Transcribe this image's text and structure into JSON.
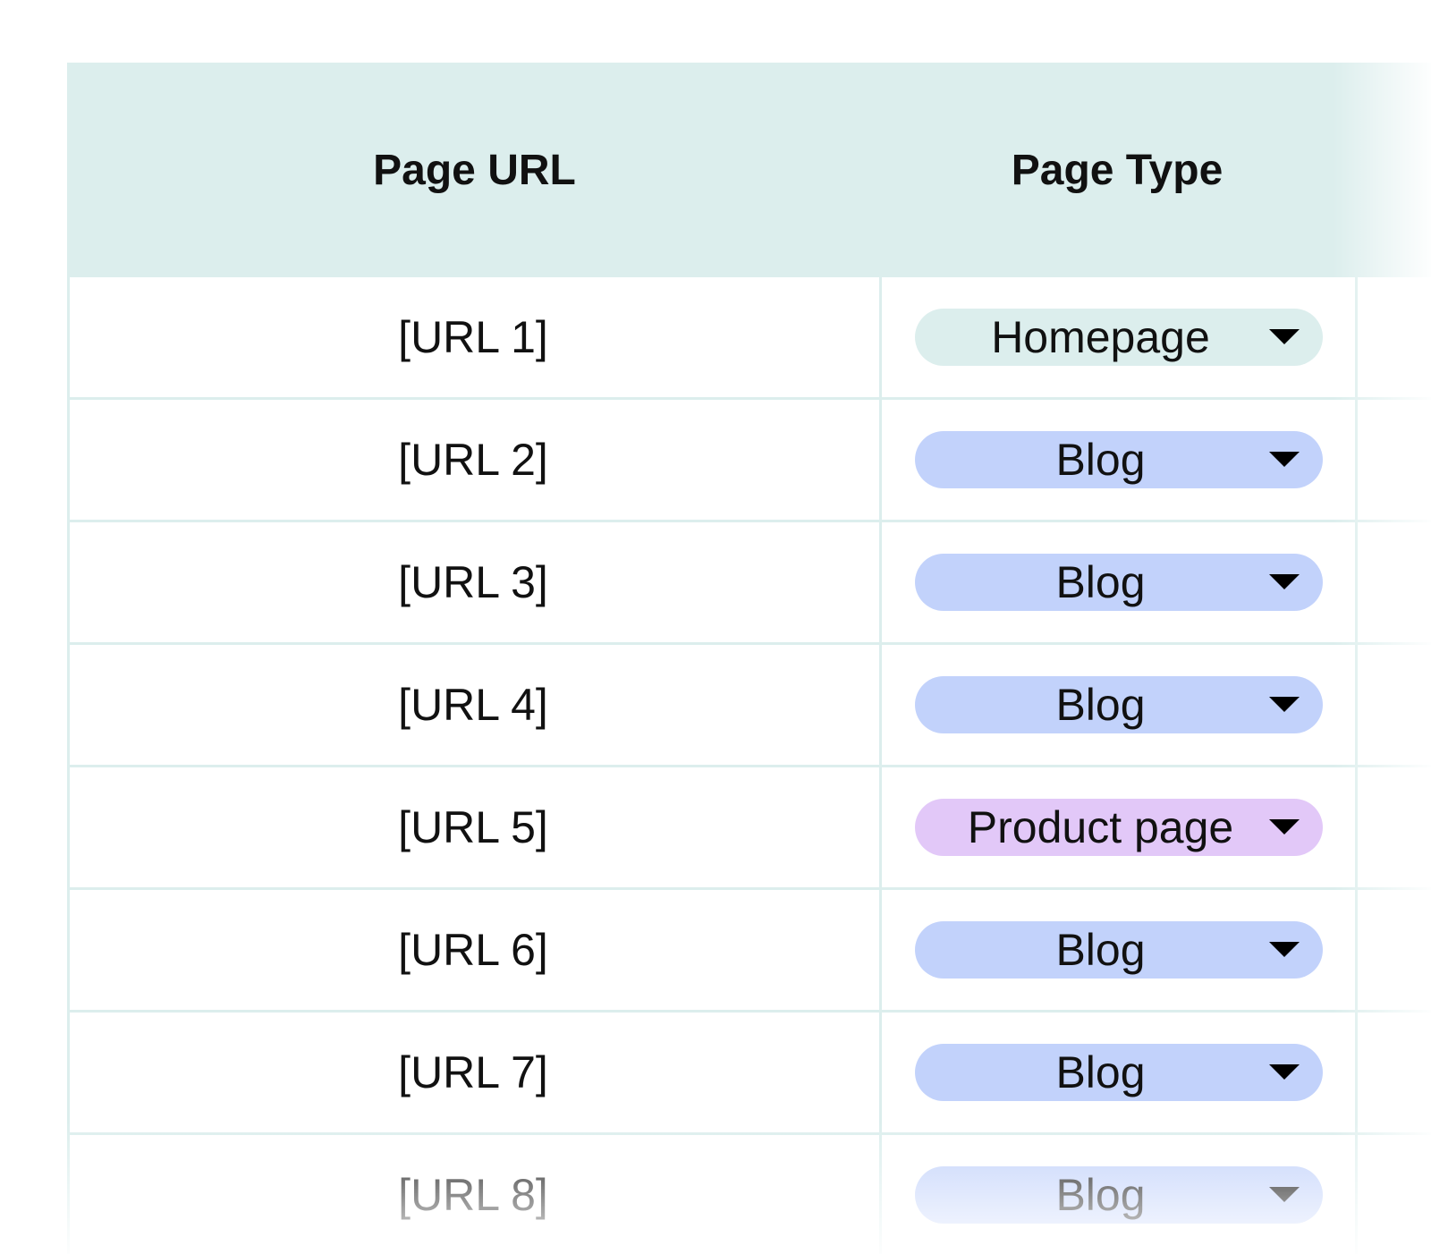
{
  "table": {
    "headers": {
      "url": "Page URL",
      "type": "Page Type"
    },
    "rows": [
      {
        "url": "[URL 1]",
        "type": "Homepage",
        "chip_color": "#dceeed"
      },
      {
        "url": "[URL 2]",
        "type": "Blog",
        "chip_color": "#c2d2fb"
      },
      {
        "url": "[URL 3]",
        "type": "Blog",
        "chip_color": "#c2d2fb"
      },
      {
        "url": "[URL 4]",
        "type": "Blog",
        "chip_color": "#c2d2fb"
      },
      {
        "url": "[URL 5]",
        "type": "Product page",
        "chip_color": "#e2c8f8"
      },
      {
        "url": "[URL 6]",
        "type": "Blog",
        "chip_color": "#c2d2fb"
      },
      {
        "url": "[URL 7]",
        "type": "Blog",
        "chip_color": "#c2d2fb"
      },
      {
        "url": "[URL 8]",
        "type": "Blog",
        "chip_color": "#c2d2fb"
      }
    ]
  },
  "colors": {
    "header_background": "#dceeed",
    "grid_line": "#dceeed",
    "blog_chip": "#c2d2fb",
    "homepage_chip": "#dceeed",
    "product_chip": "#e2c8f8"
  },
  "icons": {
    "dropdown": "chevron-down-icon"
  }
}
